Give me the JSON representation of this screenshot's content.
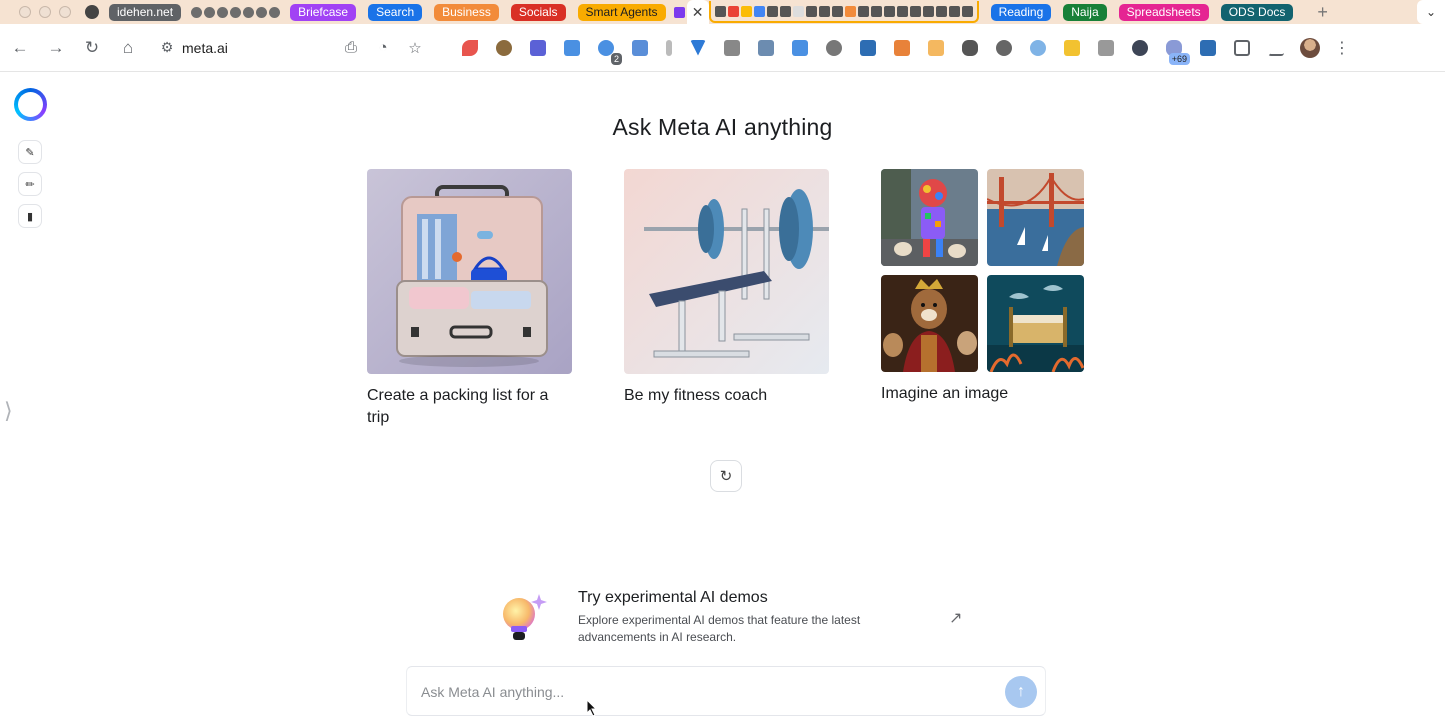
{
  "browser": {
    "tab_groups": [
      {
        "label": "idehen.net",
        "color": "#5f6266"
      },
      {
        "label": "Briefcase",
        "color": "#a142f4"
      },
      {
        "label": "Search",
        "color": "#1a73e8"
      },
      {
        "label": "Business",
        "color": "#f28b3a"
      },
      {
        "label": "Socials",
        "color": "#d93025"
      },
      {
        "label": "Smart Agents",
        "color": "#f9ab00"
      },
      {
        "label": "Reading",
        "color": "#1a73e8"
      },
      {
        "label": "Naija",
        "color": "#188038"
      },
      {
        "label": "Spreadsheets",
        "color": "#e52592"
      },
      {
        "label": "ODS Docs",
        "color": "#12636f"
      }
    ],
    "active_tab_close": "✕",
    "new_tab": "+",
    "url": "meta.ai",
    "extension_badges": {
      "notifications": "2",
      "more_count": "+69"
    }
  },
  "sidebar": {
    "logo": "meta-ai-logo",
    "items": [
      {
        "name": "new-chat-icon",
        "glyph": "✎"
      },
      {
        "name": "edit-icon",
        "glyph": "✏"
      },
      {
        "name": "library-icon",
        "glyph": "▮"
      }
    ],
    "expand_glyph": "⟩"
  },
  "main": {
    "heading": "Ask Meta AI anything",
    "cards": [
      {
        "label": "Create a packing list for a trip"
      },
      {
        "label": "Be my fitness coach"
      },
      {
        "label": "Imagine an image"
      }
    ],
    "refresh_glyph": "↻"
  },
  "demo": {
    "title": "Try experimental AI demos",
    "description": "Explore experimental AI demos that feature the latest advancements in AI research.",
    "arrow": "↗"
  },
  "composer": {
    "placeholder": "Ask Meta AI anything...",
    "value": "",
    "send_glyph": "↑"
  },
  "colors": {
    "accent": "#0064e0",
    "send_disabled": "#a8c8f0"
  }
}
